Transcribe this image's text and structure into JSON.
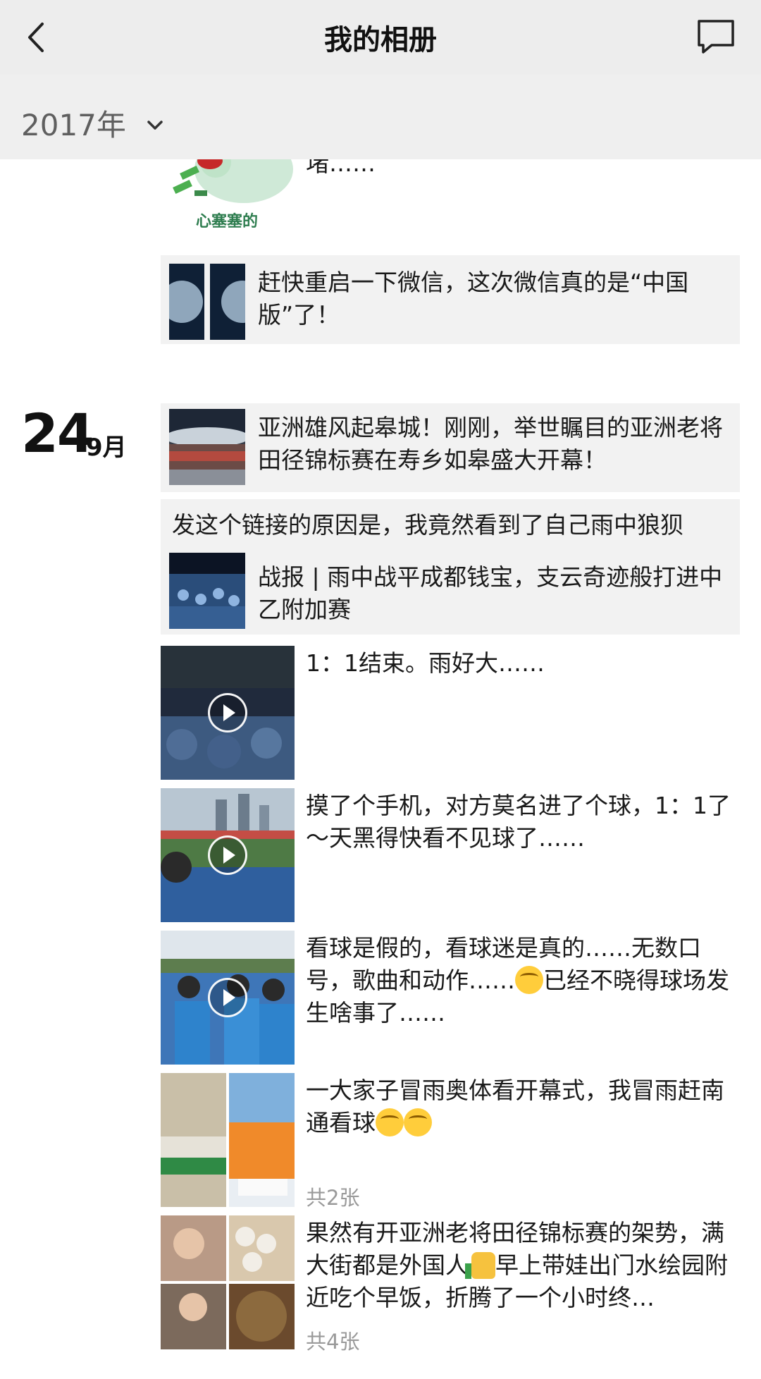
{
  "nav": {
    "title": "我的相册",
    "back_icon": "chevron-left-icon",
    "message_icon": "message-bubble-icon"
  },
  "year_selector": {
    "label": "2017年",
    "icon": "chevron-down-icon"
  },
  "top_partial": {
    "sticker_caption": "心塞塞的",
    "cut_text": "堵……"
  },
  "posts_prev": [
    {
      "text": "赶快重启一下微信，这次微信真的是“中国版”了！"
    }
  ],
  "date_group": {
    "day": "24",
    "month": "9月"
  },
  "posts": [
    {
      "type": "link",
      "text": "亚洲雄风起皋城！刚刚，举世瞩目的亚洲老将田径锦标赛在寿乡如皋盛大开幕！"
    },
    {
      "type": "share",
      "comment": "发这个链接的原因是，我竟然看到了自己雨中狼狈",
      "text": "战报 | 雨中战平成都钱宝，支云奇迹般打进中乙附加赛"
    },
    {
      "type": "video",
      "text": "1：1结束。雨好大……"
    },
    {
      "type": "video",
      "text": "摸了个手机，对方莫名进了个球，1：1了～天黑得快看不见球了……"
    },
    {
      "type": "video",
      "text": "看球是假的，看球迷是真的……无数口号，歌曲和动作……",
      "text_after": "已经不晓得球场发生啥事了……"
    },
    {
      "type": "photos",
      "text": "一大家子冒雨奥体看开幕式，我冒雨赶南通看球",
      "count": "共2张"
    },
    {
      "type": "photos",
      "text": "果然有开亚洲老将田径锦标赛的架势，满大街都是外国人",
      "text_after": "早上带娃出门水绘园附近吃个早饭，折腾了一个小时终…",
      "count": "共4张"
    }
  ]
}
